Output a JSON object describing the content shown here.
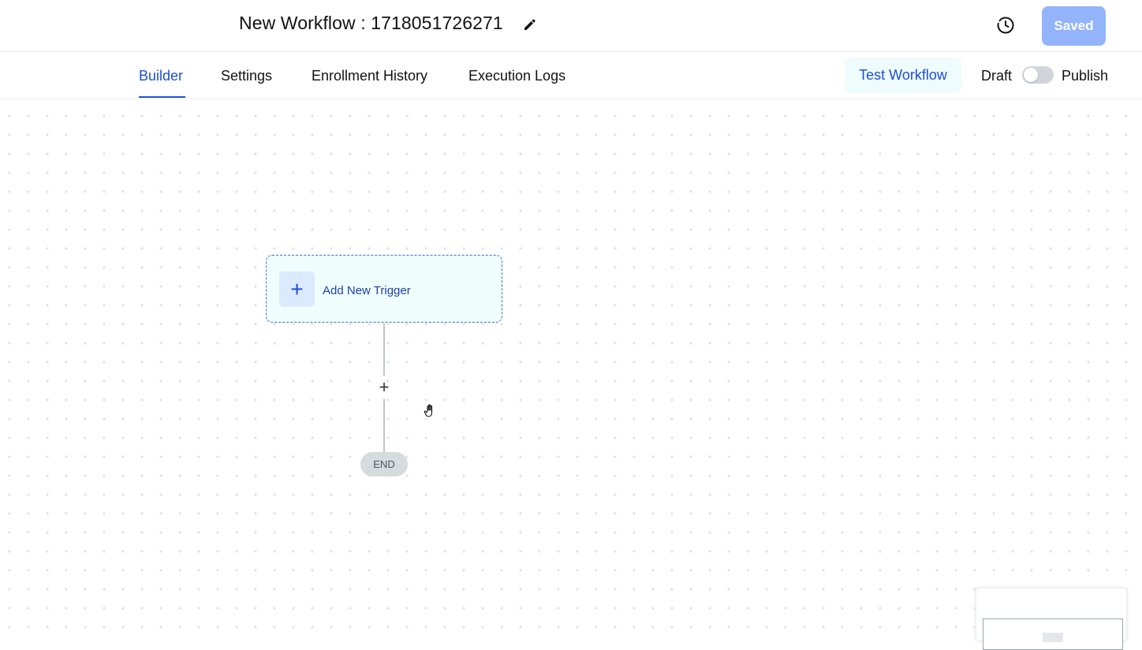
{
  "header": {
    "title": "New Workflow : 1718051726271",
    "saved_label": "Saved"
  },
  "tabs": [
    {
      "label": "Builder",
      "active": true
    },
    {
      "label": "Settings",
      "active": false
    },
    {
      "label": "Enrollment History",
      "active": false
    },
    {
      "label": "Execution Logs",
      "active": false
    }
  ],
  "actions": {
    "test_label": "Test Workflow",
    "draft_label": "Draft",
    "publish_label": "Publish",
    "published": false
  },
  "canvas": {
    "trigger_label": "Add New Trigger",
    "add_step_symbol": "+",
    "end_label": "END"
  },
  "icons": {
    "edit": "pencil-icon",
    "history": "history-clock-icon",
    "cursor": "hand-cursor-icon"
  },
  "colors": {
    "accent": "#1d4ed8",
    "saved_button": "#93b4fb",
    "test_button_bg": "#eefcfd",
    "trigger_bg": "#effdfc"
  }
}
